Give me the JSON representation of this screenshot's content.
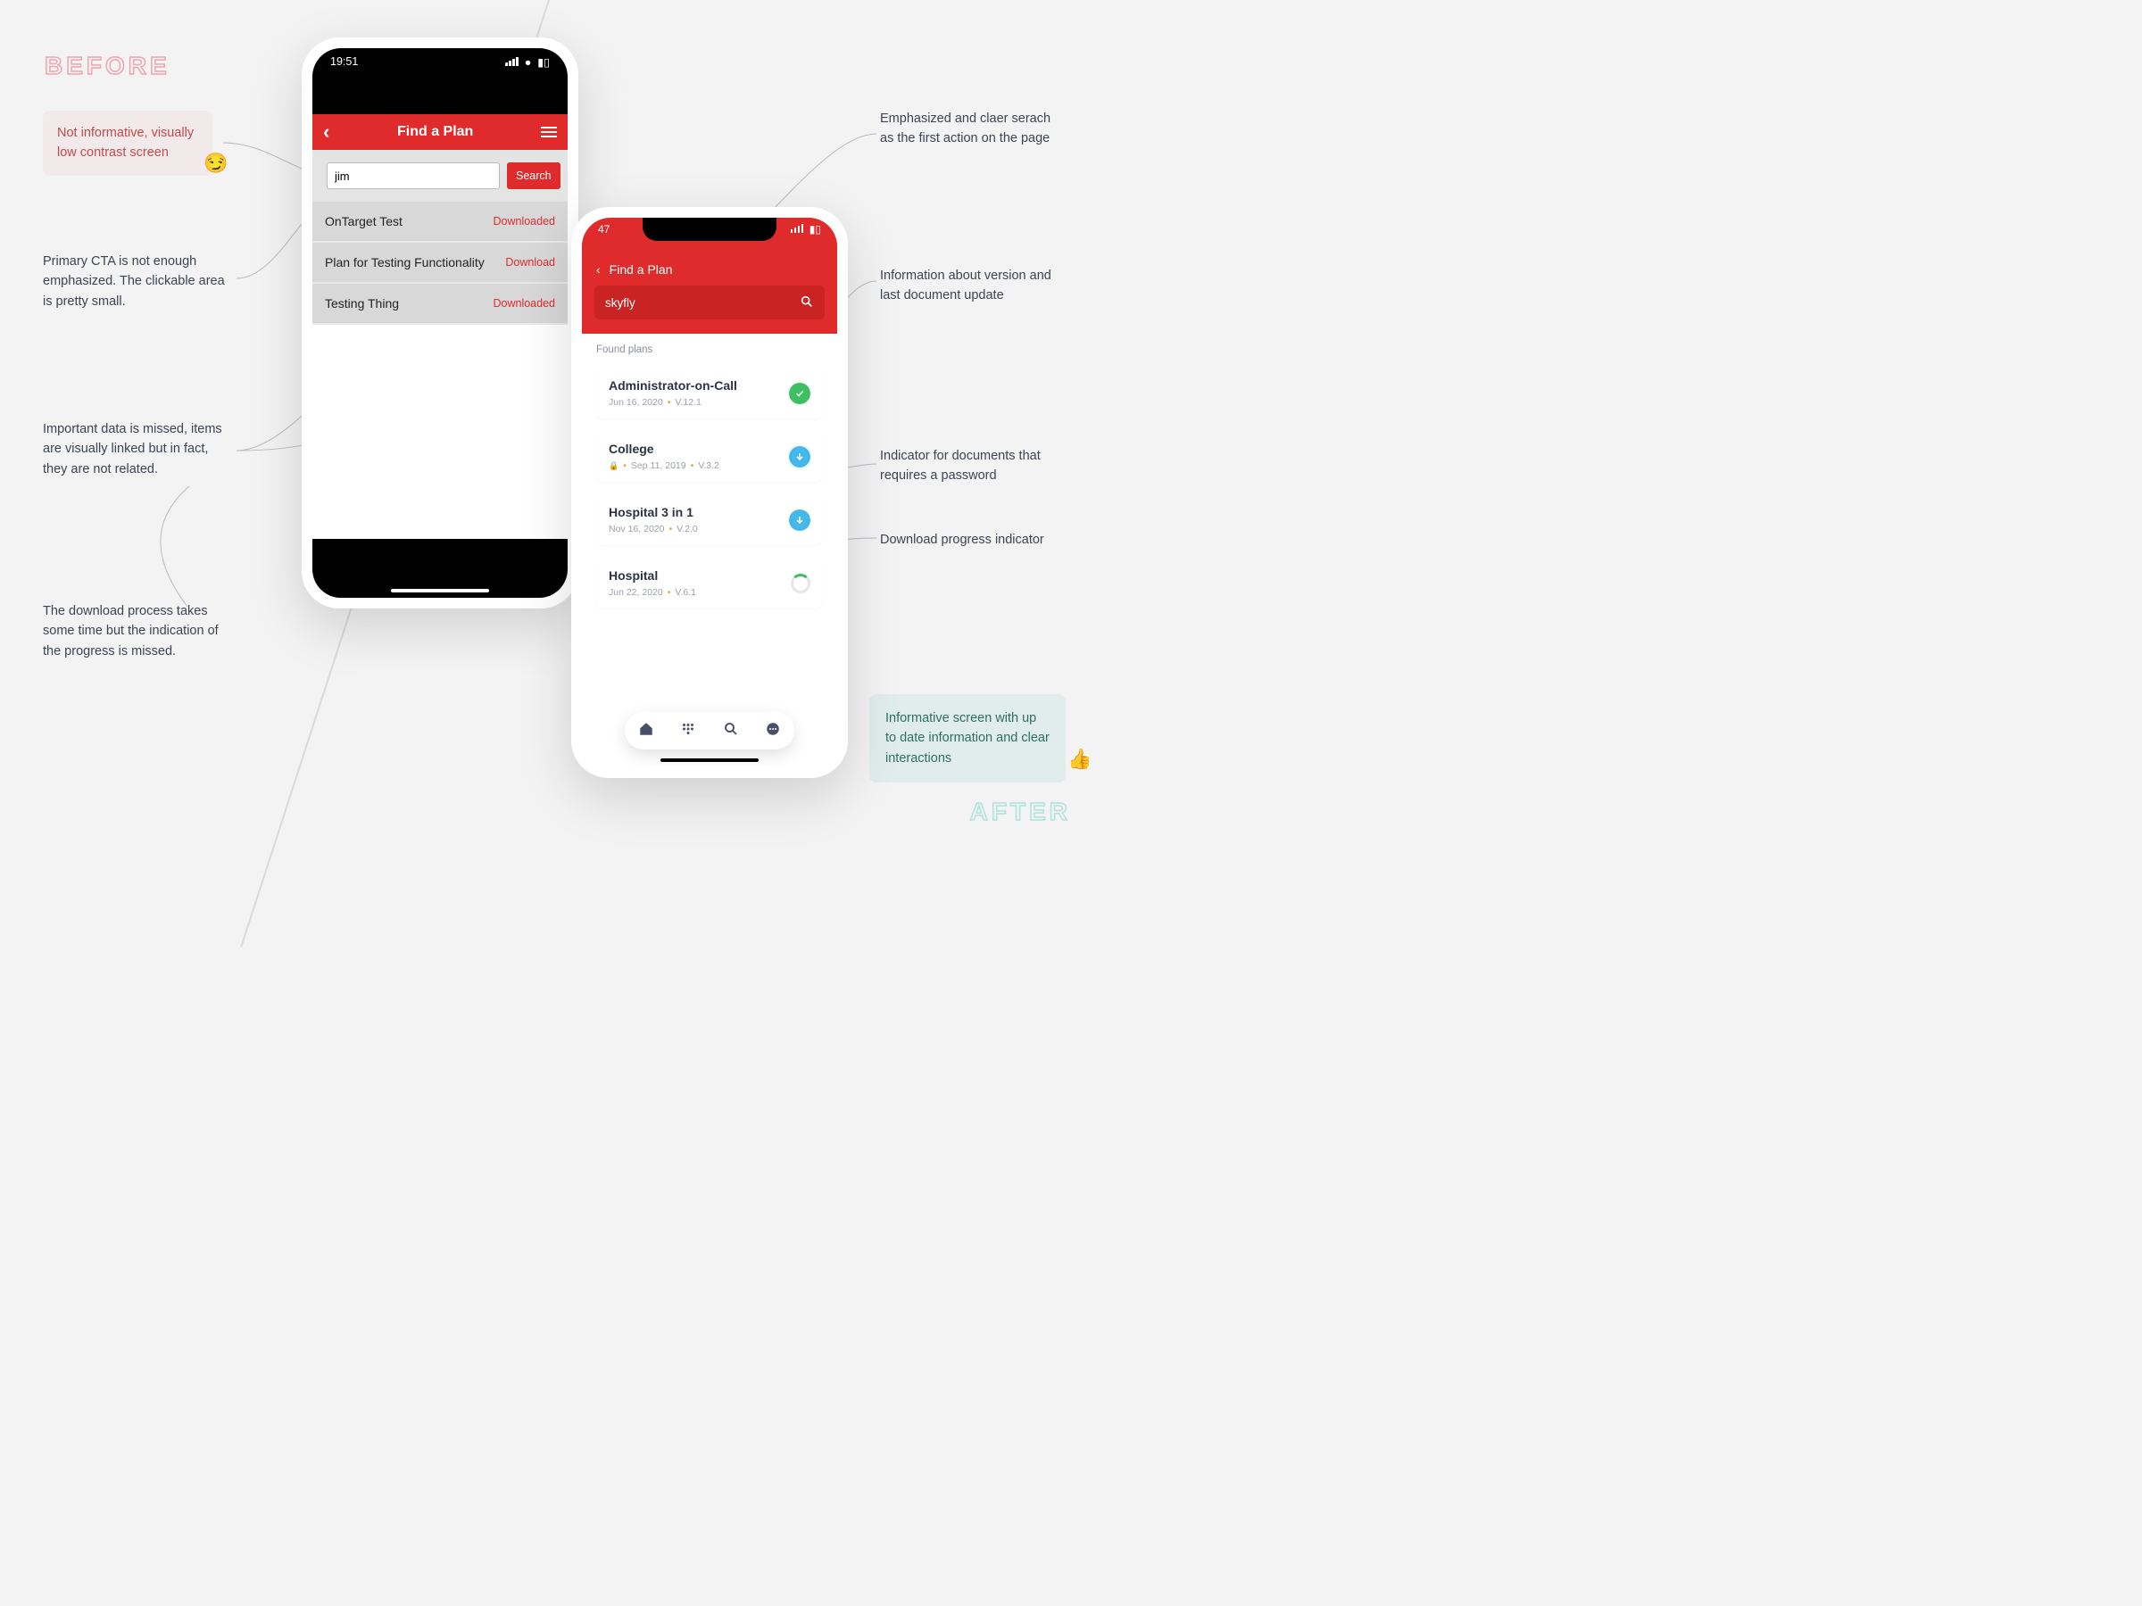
{
  "labels": {
    "before": "BEFORE",
    "after": "AFTER"
  },
  "before": {
    "status_time": "19:51",
    "nav_title": "Find a Plan",
    "search_value": "jim",
    "search_button": "Search",
    "rows": [
      {
        "name": "OnTarget Test",
        "status": "Downloaded"
      },
      {
        "name": "Plan for Testing Functionality",
        "status": "Download"
      },
      {
        "name": "Testing Thing",
        "status": "Downloaded"
      }
    ]
  },
  "after": {
    "status_time": "47",
    "nav_title": "Find a Plan",
    "search_value": "skyfly",
    "section_heading": "Found plans",
    "plans": [
      {
        "name": "Administrator-on-Call",
        "date": "Jun 16, 2020",
        "version": "V.12.1",
        "locked": false,
        "state": "done"
      },
      {
        "name": "College",
        "date": "Sep 11, 2019",
        "version": "V.3.2",
        "locked": true,
        "state": "download"
      },
      {
        "name": "Hospital 3 in 1",
        "date": "Nov 16, 2020",
        "version": "V.2.0",
        "locked": false,
        "state": "download"
      },
      {
        "name": "Hospital",
        "date": "Jun 22, 2020",
        "version": "V.6.1",
        "locked": false,
        "state": "loading"
      }
    ]
  },
  "annotations": {
    "a1": "Not informative, visually low contrast screen",
    "a2": "Primary CTA is not enough emphasized. The clickable area is pretty small.",
    "a3": "Important data is missed, items are visually linked but in fact, they are not related.",
    "a4": "The download process takes some time but the indication of the progress is missed.",
    "b1": "Emphasized and claer serach as the first action on the page",
    "b2": "Information about version and last document update",
    "b3": "Indicator for documents that requires a password",
    "b4": "Download progress indicator",
    "b5": "Informative screen with up to date information and clear interactions"
  }
}
